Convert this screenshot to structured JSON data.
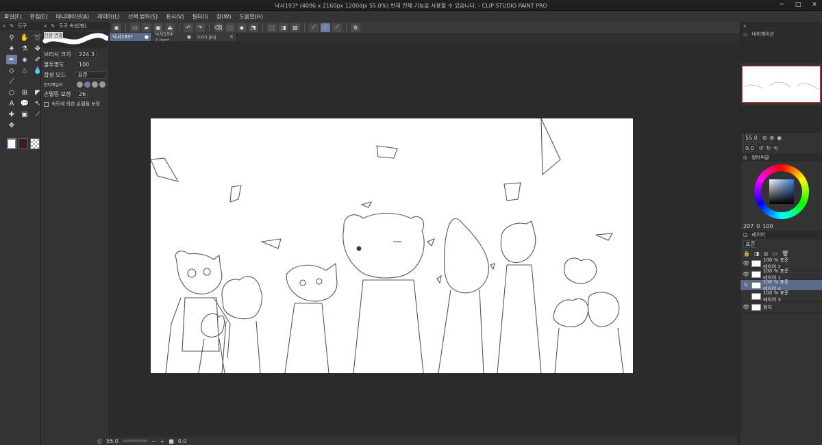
{
  "window": {
    "title": "낙서193* (4096 x 2160px 1200dpi 55.0%)  현재 전체 기능을 사용할 수 있습니다. - CLIP STUDIO PAINT PRO",
    "controls": [
      "─",
      "□",
      "✕"
    ]
  },
  "menu": [
    "파일(F)",
    "편집(E)",
    "애니메이션(A)",
    "레이어(L)",
    "선택 범위(S)",
    "표시(V)",
    "필터(I)",
    "창(W)",
    "도움말(H)"
  ],
  "tabs": [
    {
      "label": "낙서193*",
      "active": true
    },
    {
      "label": "낙서194-2.jpg*",
      "active": false
    },
    {
      "label": "icon.jpg",
      "active": false
    }
  ],
  "tool_panel": {
    "header": "도구",
    "tools": [
      "zoom-icon",
      "hand-icon",
      "lasso-icon",
      "wand-icon",
      "eyedropper-icon",
      "move-icon",
      "pen-icon",
      "fill-icon",
      "brush-icon",
      "eraser-icon",
      "smudge-icon",
      "water-icon",
      "ruler-icon",
      "",
      "",
      "ellipse-icon",
      "frame-icon",
      "gradient-icon",
      "text-icon",
      "balloon-icon",
      "correction-icon",
      "operation-icon",
      "stamp-icon",
      "dropper-icon",
      "transform-icon",
      "",
      ""
    ]
  },
  "props_panel": {
    "header": "도구 속성[펜]",
    "brush_name": "진한 연필",
    "brush_size_label": "브러시 크기",
    "brush_size_value": "224.3",
    "opacity_label": "불투명도",
    "opacity_value": "100",
    "blend_label": "합성 모드",
    "blend_value": "표준",
    "antialias_label": "안티에일리",
    "stabilize_label": "손떨림 보정",
    "stabilize_value": "26",
    "speed_label": "속도에 의한 손떨림 보정"
  },
  "status": {
    "zoom": "55.0",
    "angle": "0.0"
  },
  "navigator": {
    "header": "내비게이션",
    "zoom": "55.0",
    "angle": "0.0"
  },
  "color": {
    "header": "컬러써클",
    "h": "207",
    "s": "0",
    "v": "100"
  },
  "layers": {
    "header": "레이어",
    "blend": "표준",
    "items": [
      {
        "name": "100 % 표준\n레이어 2",
        "line1": "100 % 표준",
        "line2": "레이어 2",
        "selected": false
      },
      {
        "name": "100 % 표준\n레이어 1",
        "line1": "100 % 표준",
        "line2": "레이어 1",
        "selected": false
      },
      {
        "name": "100 % 표준\n레이어 4",
        "line1": "100 % 표준",
        "line2": "레이어 4",
        "selected": true
      },
      {
        "name": "100 % 표준\n레이어 3",
        "line1": "100 % 표준",
        "line2": "레이어 3",
        "selected": false
      },
      {
        "name": "용지",
        "line1": "",
        "line2": "용지",
        "selected": false
      }
    ]
  },
  "colors": {
    "accent": "#6e7fa6",
    "selected_layer": "#5b6b8c",
    "canvas_bg": "#2b2b2b",
    "main_color": "#ffffff",
    "sub_color": "#3a1f1f"
  }
}
